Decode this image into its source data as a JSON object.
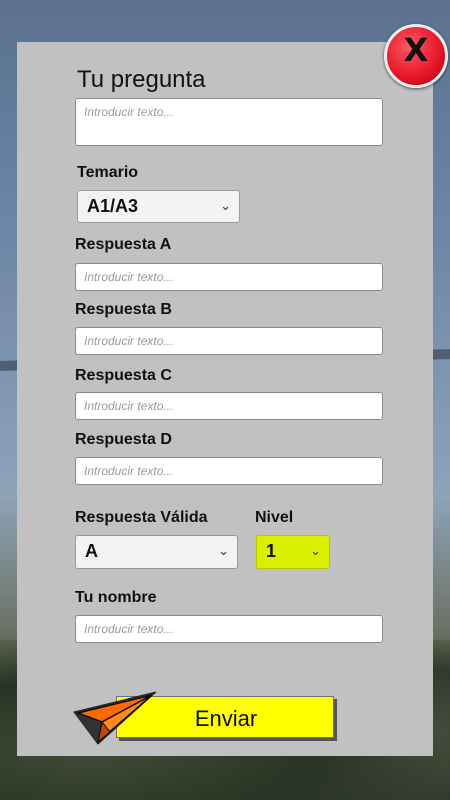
{
  "form": {
    "title": "Tu pregunta",
    "question_placeholder": "Introducir texto...",
    "temario_label": "Temario",
    "temario_value": "A1/A3",
    "respuestas": [
      {
        "label": "Respuesta A",
        "placeholder": "Introducir texto..."
      },
      {
        "label": "Respuesta B",
        "placeholder": "Introducir texto..."
      },
      {
        "label": "Respuesta C",
        "placeholder": "Introducir texto..."
      },
      {
        "label": "Respuesta D",
        "placeholder": "Introducir texto..."
      }
    ],
    "valida_label": "Respuesta Válida",
    "valida_value": "A",
    "nivel_label": "Nivel",
    "nivel_value": "1",
    "nombre_label": "Tu nombre",
    "nombre_placeholder": "Introducir texto...",
    "send_label": "Enviar",
    "close_glyph": "X"
  },
  "icons": {
    "close": "close-icon",
    "send": "paper-plane-icon",
    "dropdown": "chevron-down-icon"
  },
  "colors": {
    "panel": "#c1c1c1",
    "send_button": "#ffff00",
    "nivel_select": "#d8f000",
    "close_button": "#e8192b",
    "plane": "#ff6a00"
  }
}
